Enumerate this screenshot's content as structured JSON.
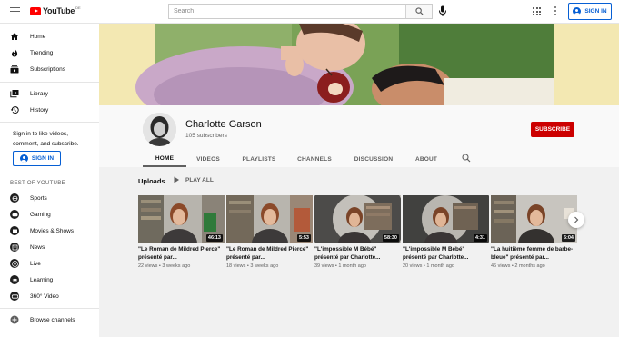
{
  "header": {
    "logo_text": "YouTube",
    "logo_region": "DE",
    "search_placeholder": "Search",
    "signin_label": "SIGN IN"
  },
  "sidebar": {
    "main_items": [
      {
        "label": "Home",
        "icon": "home-icon"
      },
      {
        "label": "Trending",
        "icon": "trending-icon"
      },
      {
        "label": "Subscriptions",
        "icon": "subscriptions-icon"
      }
    ],
    "library_items": [
      {
        "label": "Library",
        "icon": "library-icon"
      },
      {
        "label": "History",
        "icon": "history-icon"
      }
    ],
    "signin_note": "Sign in to like videos, comment, and subscribe.",
    "signin_label": "SIGN IN",
    "best_of_heading": "BEST OF YOUTUBE",
    "best_of_items": [
      {
        "label": "Sports"
      },
      {
        "label": "Gaming"
      },
      {
        "label": "Movies & Shows"
      },
      {
        "label": "News"
      },
      {
        "label": "Live"
      },
      {
        "label": "Learning"
      },
      {
        "label": "360° Video"
      }
    ],
    "browse_channels": "Browse channels"
  },
  "channel": {
    "name": "Charlotte Garson",
    "subscribers": "105 subscribers",
    "subscribe_label": "SUBSCRIBE",
    "tabs": [
      "HOME",
      "VIDEOS",
      "PLAYLISTS",
      "CHANNELS",
      "DISCUSSION",
      "ABOUT"
    ],
    "active_tab": "HOME"
  },
  "uploads": {
    "title": "Uploads",
    "play_all": "PLAY ALL",
    "videos": [
      {
        "title": "\"Le Roman de Mildred Pierce\" présenté par...",
        "duration": "46:13",
        "meta": "22 views • 3 weeks ago"
      },
      {
        "title": "\"Le Roman de Mildred Pierce\" présenté par...",
        "duration": "5:53",
        "meta": "18 views • 3 weeks ago"
      },
      {
        "title": "\"L'impossible M Bébé\" présenté par Charlotte...",
        "duration": "58:30",
        "meta": "39 views • 1 month ago"
      },
      {
        "title": "\"L'impossible M Bébé\" présenté par Charlotte...",
        "duration": "4:31",
        "meta": "20 views • 1 month ago"
      },
      {
        "title": "\"La huitième femme de barbe-bleue\" présenté par...",
        "duration": "5:04",
        "meta": "46 views • 2 months ago"
      }
    ]
  },
  "colors": {
    "subscribe": "#cc0000",
    "link_blue": "#065fd4",
    "banner_bg": "#f5e9b0"
  }
}
